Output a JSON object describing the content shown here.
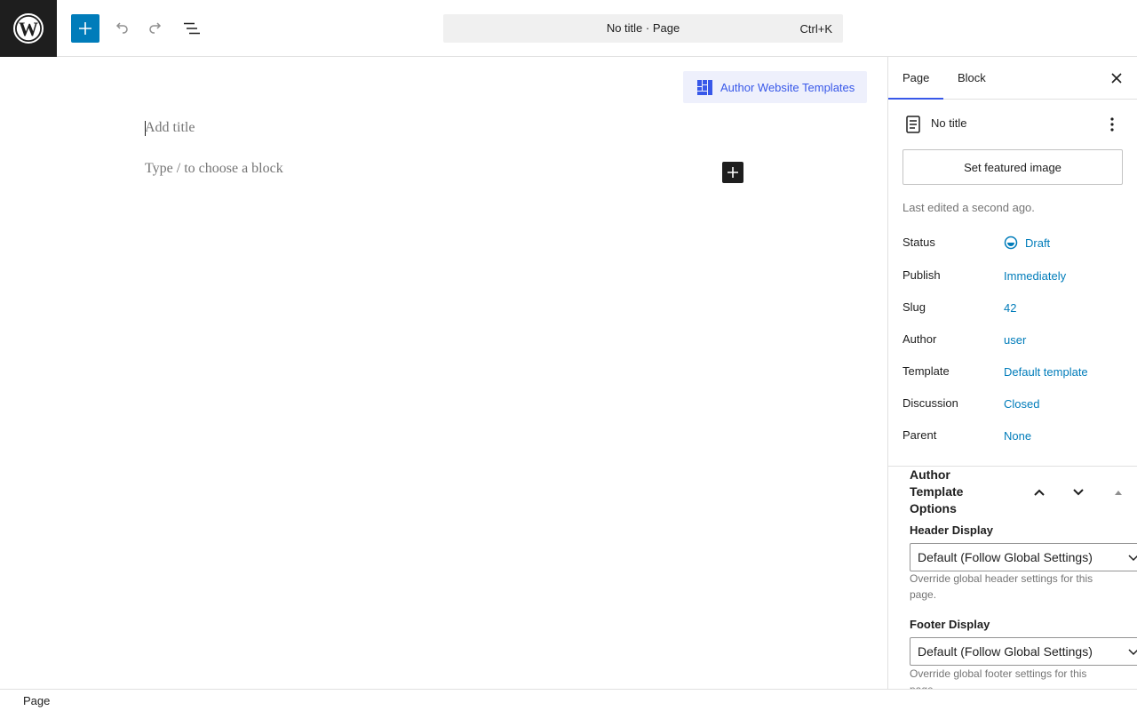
{
  "topbar": {
    "logo_icon": "wordpress-logo-icon",
    "add_block_icon": "plus-icon",
    "undo_icon": "undo-icon",
    "redo_icon": "redo-icon",
    "list_view_icon": "list-view-icon",
    "command": {
      "title": "No title · Page",
      "shortcut": "Ctrl+K"
    }
  },
  "canvas": {
    "template_button_label": "Author Website Templates",
    "title_placeholder": "Add title",
    "block_placeholder": "Type / to choose a block"
  },
  "sidebar": {
    "tabs": [
      {
        "label": "Page",
        "active": true
      },
      {
        "label": "Block",
        "active": false
      }
    ],
    "document_title": "No title",
    "featured_image_label": "Set featured image",
    "last_edited": "Last edited a second ago.",
    "meta": [
      {
        "label": "Status",
        "value": "Draft"
      },
      {
        "label": "Publish",
        "value": "Immediately"
      },
      {
        "label": "Slug",
        "value": "42"
      },
      {
        "label": "Author",
        "value": "user"
      },
      {
        "label": "Template",
        "value": "Default template"
      },
      {
        "label": "Discussion",
        "value": "Closed"
      },
      {
        "label": "Parent",
        "value": "None"
      }
    ],
    "panel": {
      "title": "Author Template Options",
      "fields": [
        {
          "label": "Header Display",
          "value": "Default (Follow Global Settings)",
          "help": "Override global header settings for this page."
        },
        {
          "label": "Footer Display",
          "value": "Default (Follow Global Settings)",
          "help": "Override global footer settings for this page."
        }
      ]
    }
  },
  "footer": {
    "breadcrumb": "Page"
  },
  "colors": {
    "accent": "#007cba",
    "admin_theme": "#3858e9",
    "dark": "#1e1e1e",
    "muted": "#757575"
  }
}
